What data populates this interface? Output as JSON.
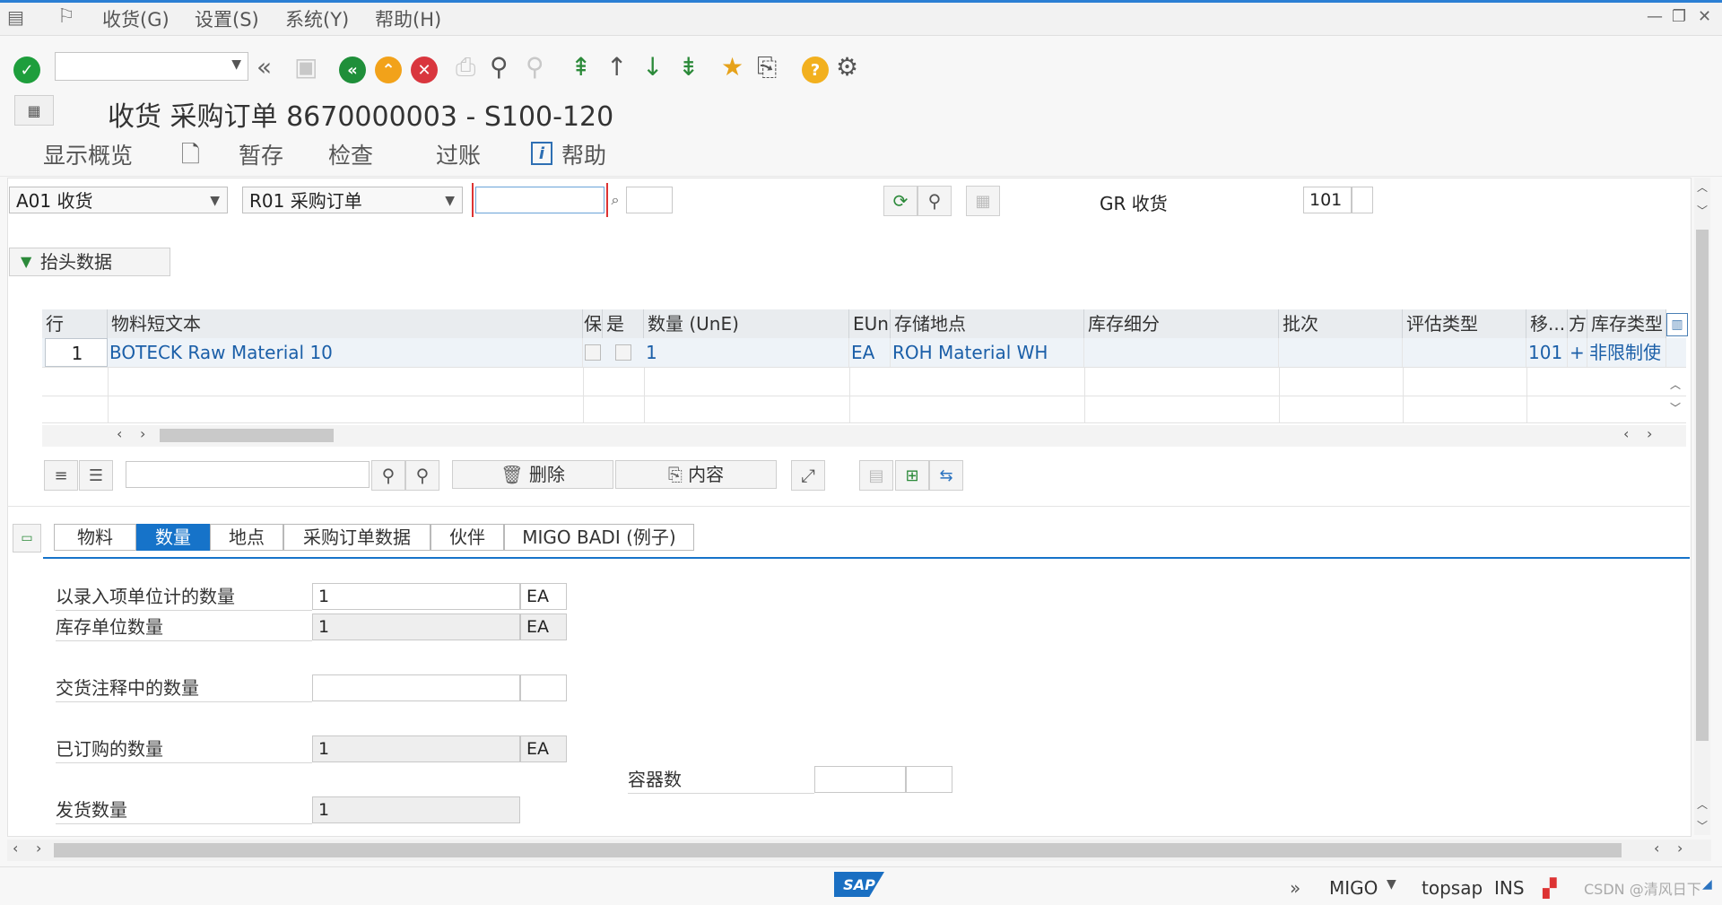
{
  "menu": {
    "items": [
      "收货(G)",
      "设置(S)",
      "系统(Y)",
      "帮助(H)"
    ]
  },
  "toolbar": {
    "command_field_value": ""
  },
  "title": "收货 采购订单 8670000003 - S100-120",
  "app_toolbar": {
    "show_overview": "显示概览",
    "hold": "暂存",
    "check": "检查",
    "post": "过账",
    "help": "帮助"
  },
  "selection": {
    "action": "A01 收货",
    "reference": "R01 采购订单",
    "po_number": "",
    "gr_label": "GR 收货",
    "movement_type": "101"
  },
  "header_data_button": "抬头数据",
  "grid": {
    "columns": [
      "行",
      "物料短文本",
      "保",
      "是",
      "数量 (UnE)",
      "EUn",
      "存储地点",
      "库存细分",
      "批次",
      "评估类型",
      "移...",
      "方",
      "库存类型"
    ],
    "rows": [
      {
        "line": "1",
        "material_text": "BOTECK Raw Material 10",
        "quantity": "1",
        "unit": "EA",
        "storage_location": "ROH Material WH",
        "stock_segment": "",
        "batch": "",
        "valuation_type": "",
        "movement_type": "101",
        "direction": "+",
        "stock_type": "非限制使"
      }
    ]
  },
  "item_toolbar": {
    "search_value": "",
    "delete": "删除",
    "contents": "内容"
  },
  "tabs": [
    "物料",
    "数量",
    "地点",
    "采购订单数据",
    "伙伴",
    "MIGO BADI (例子)"
  ],
  "quantity_tab": {
    "qty_entry_unit_label": "以录入项单位计的数量",
    "qty_entry_unit_value": "1",
    "qty_entry_unit_uom": "EA",
    "qty_stock_unit_label": "库存单位数量",
    "qty_stock_unit_value": "1",
    "qty_stock_unit_uom": "EA",
    "qty_delivery_note_label": "交货注释中的数量",
    "qty_delivery_note_value": "",
    "qty_delivery_note_uom": "",
    "qty_ordered_label": "已订购的数量",
    "qty_ordered_value": "1",
    "qty_ordered_uom": "EA",
    "containers_label": "容器数",
    "qty_delivered_label": "发货数量",
    "qty_delivered_value": "1"
  },
  "status_bar": {
    "transaction": "MIGO",
    "system": "topsap",
    "mode": "INS",
    "watermark": "CSDN @清风日下"
  },
  "colors": {
    "accent": "#1673c9",
    "ok_green": "#1e9e3c",
    "back_green": "#1f8f3a",
    "exit_orange": "#f2a21a",
    "cancel_red": "#d9363e"
  }
}
